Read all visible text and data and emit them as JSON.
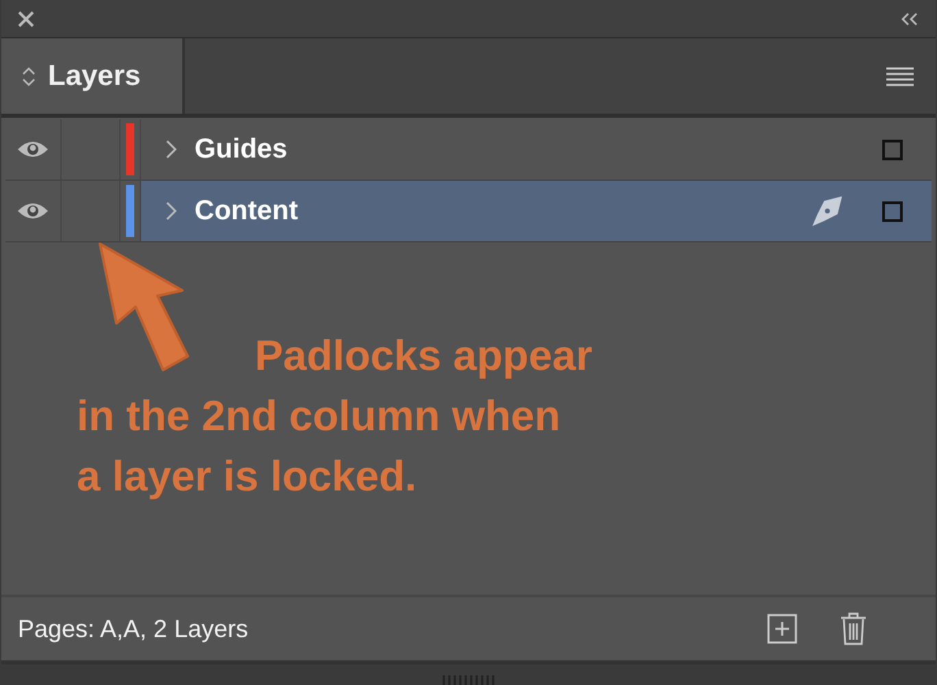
{
  "panel": {
    "title": "Layers"
  },
  "layers": [
    {
      "name": "Guides",
      "visible": true,
      "color": "#e8352a",
      "selected": false,
      "pen": false
    },
    {
      "name": "Content",
      "visible": true,
      "color": "#5b93e8",
      "selected": true,
      "pen": true
    }
  ],
  "annotation": {
    "lines": [
      "Padlocks appear",
      "in the 2nd column when",
      "a layer is locked."
    ]
  },
  "status_bar": {
    "text": "Pages: A,A, 2 Layers"
  }
}
